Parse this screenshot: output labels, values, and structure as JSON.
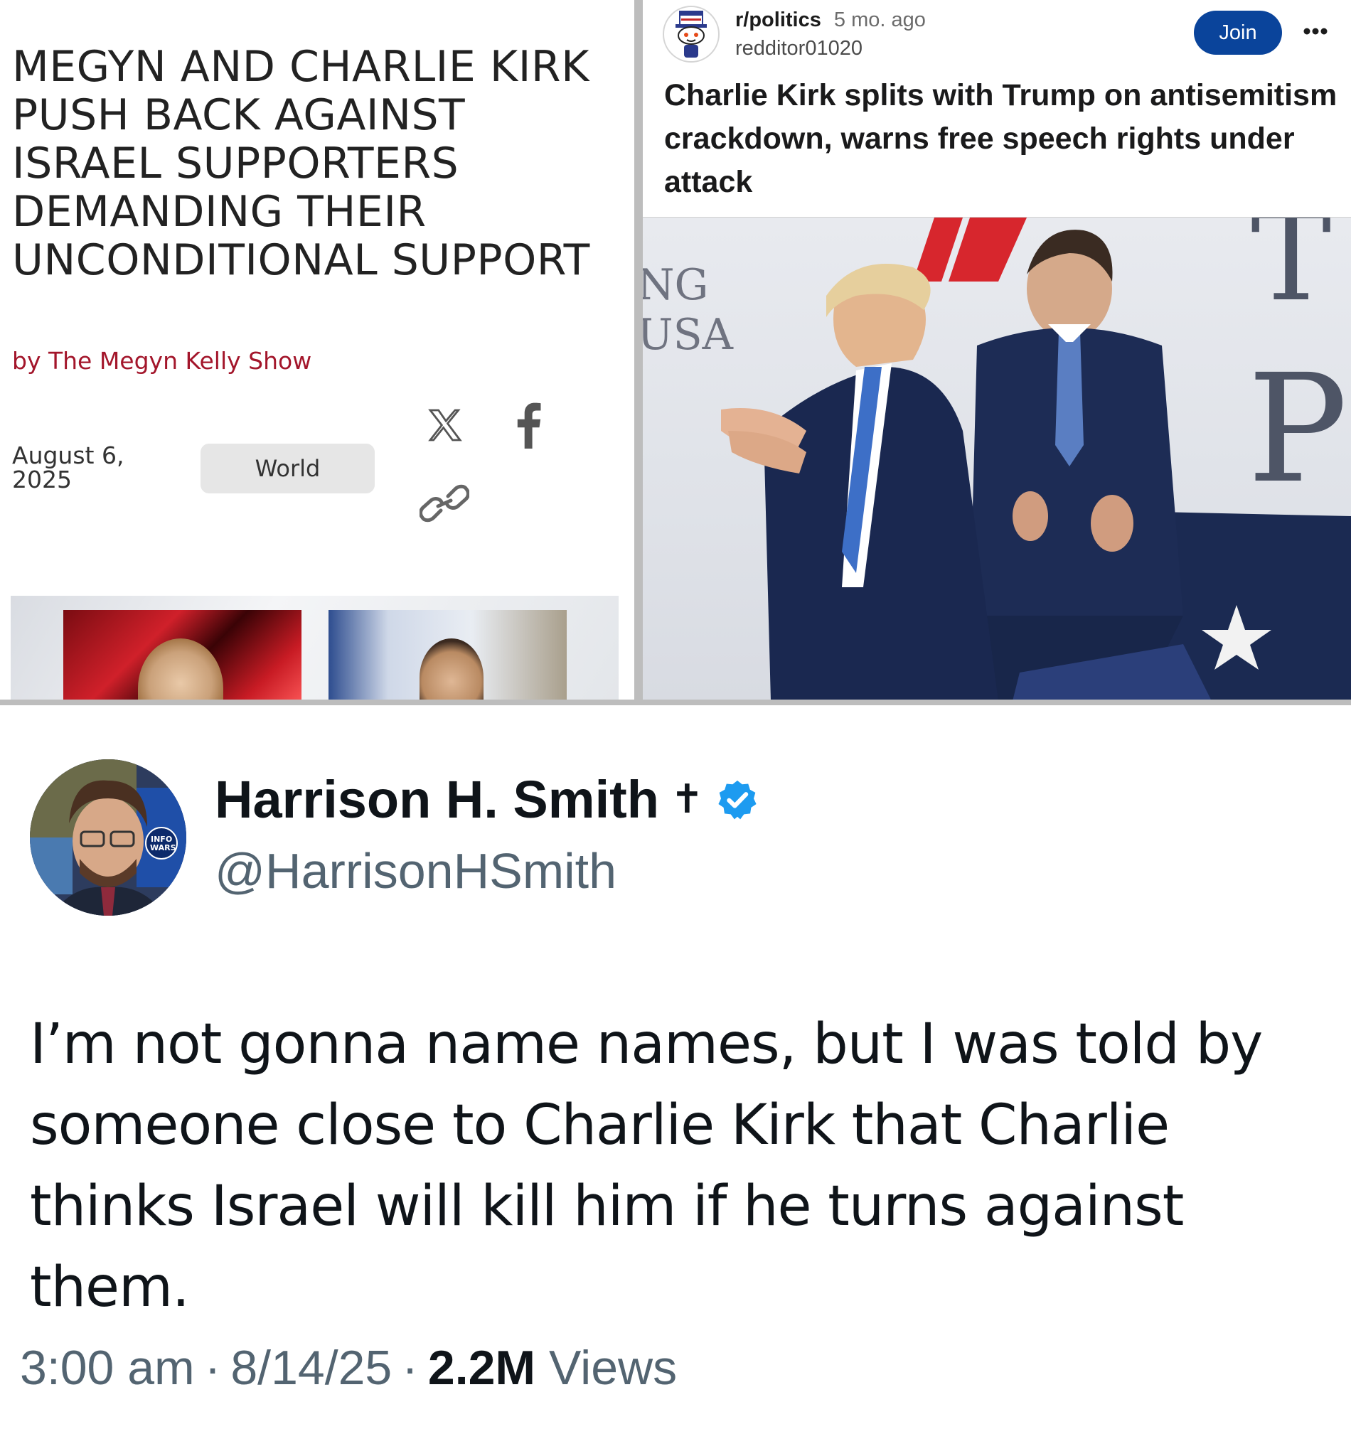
{
  "article": {
    "title": "MEGYN AND CHARLIE KIRK PUSH BACK AGAINST ISRAEL SUPPORTERS DEMANDING THEIR UNCONDITIONAL SUPPORT",
    "byline": "by The Megyn Kelly Show",
    "date": "August 6, 2025",
    "category": "World",
    "share_icons": [
      "x-icon",
      "facebook-icon",
      "link-icon"
    ]
  },
  "reddit": {
    "subreddit": "r/politics",
    "post_age": "5 mo. ago",
    "username": "redditor01020",
    "join_label": "Join",
    "title": "Charlie Kirk splits with Trump on antisemitism crackdown, warns free speech rights under attack",
    "image_backdrop_text_left": "NG\nUSA",
    "image_backdrop_text_right": "T\nP",
    "accent_color": "#0a449b"
  },
  "tweet": {
    "display_name": "Harrison H. Smith",
    "name_symbol": "✝",
    "handle": "@HarrisonHSmith",
    "text": "I’m not gonna name names, but I was told by someone close to Charlie Kirk that Charlie thinks Israel will kill him if he turns against them.",
    "time": "3:00 am",
    "date": "8/14/25",
    "views_count": "2.2M",
    "views_label": "Views",
    "verified_color": "#1d9bf0"
  }
}
